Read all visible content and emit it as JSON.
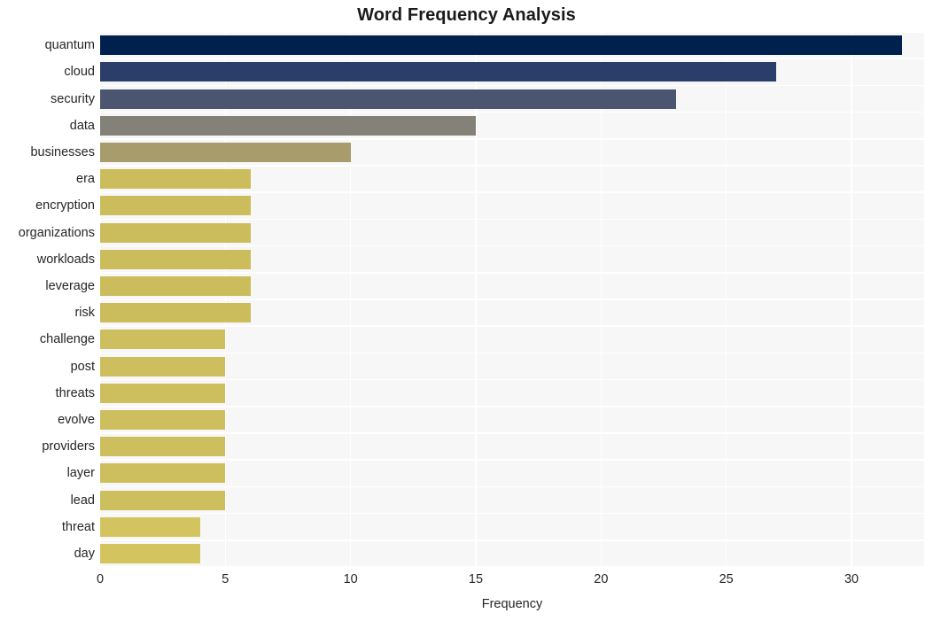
{
  "chart_data": {
    "type": "bar",
    "orientation": "horizontal",
    "title": "Word Frequency Analysis",
    "xlabel": "Frequency",
    "ylabel": "",
    "xlim": [
      0,
      32.9
    ],
    "xticks": [
      0,
      5,
      10,
      15,
      20,
      25,
      30
    ],
    "xtick_labels": [
      "0",
      "5",
      "10",
      "15",
      "20",
      "25",
      "30"
    ],
    "grid": true,
    "grid_color": "#ffffff",
    "plot_background": "#f7f7f7",
    "figure_background": "#ffffff",
    "legend": null,
    "categories": [
      "quantum",
      "cloud",
      "security",
      "data",
      "businesses",
      "era",
      "encryption",
      "organizations",
      "workloads",
      "leverage",
      "risk",
      "challenge",
      "post",
      "threats",
      "evolve",
      "providers",
      "layer",
      "lead",
      "threat",
      "day"
    ],
    "values": [
      32,
      27,
      23,
      15,
      10,
      6,
      6,
      6,
      6,
      6,
      6,
      5,
      5,
      5,
      5,
      5,
      5,
      5,
      4,
      4
    ],
    "bar_colors": [
      "#00214e",
      "#2a3d6b",
      "#4b5570",
      "#848179",
      "#a89c6d",
      "#cbbc5c",
      "#cbbc5c",
      "#cbbc5c",
      "#cbbc5c",
      "#cbbc5c",
      "#cbbc5c",
      "#cdbe5e",
      "#cdbe5e",
      "#cdbe5e",
      "#cdbe5e",
      "#cdbe5e",
      "#cdbe5e",
      "#cdbe5e",
      "#d3c45f",
      "#d3c45f"
    ]
  }
}
